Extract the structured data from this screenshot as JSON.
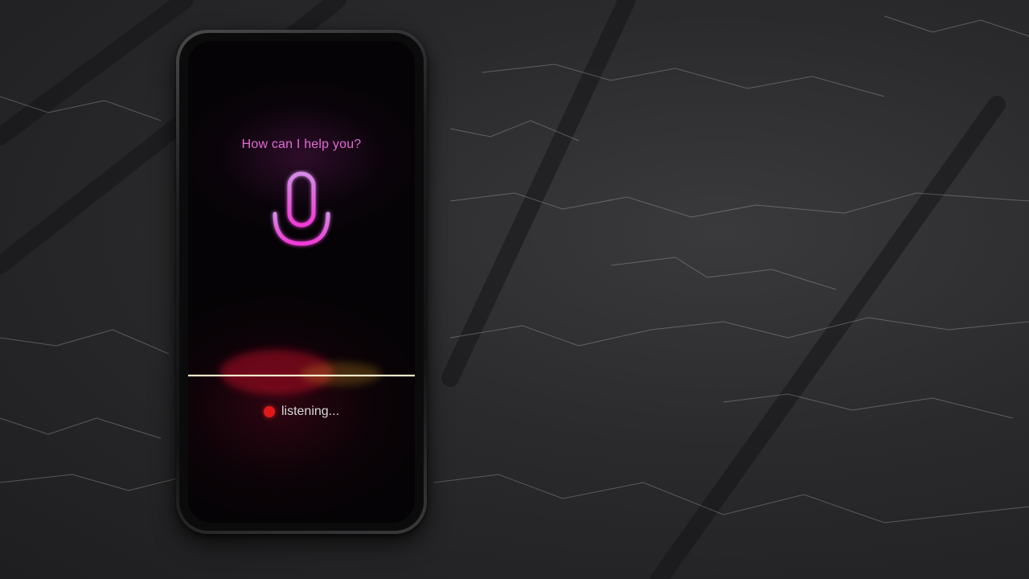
{
  "assistant": {
    "prompt": "How can I help you?",
    "status": "listening..."
  },
  "icons": {
    "microphone": "microphone-icon",
    "recording_indicator": "record-dot-icon"
  },
  "colors": {
    "accent_magenta": "#e46ad7",
    "recording_red": "#e01818",
    "status_text": "#d9d9d9"
  }
}
